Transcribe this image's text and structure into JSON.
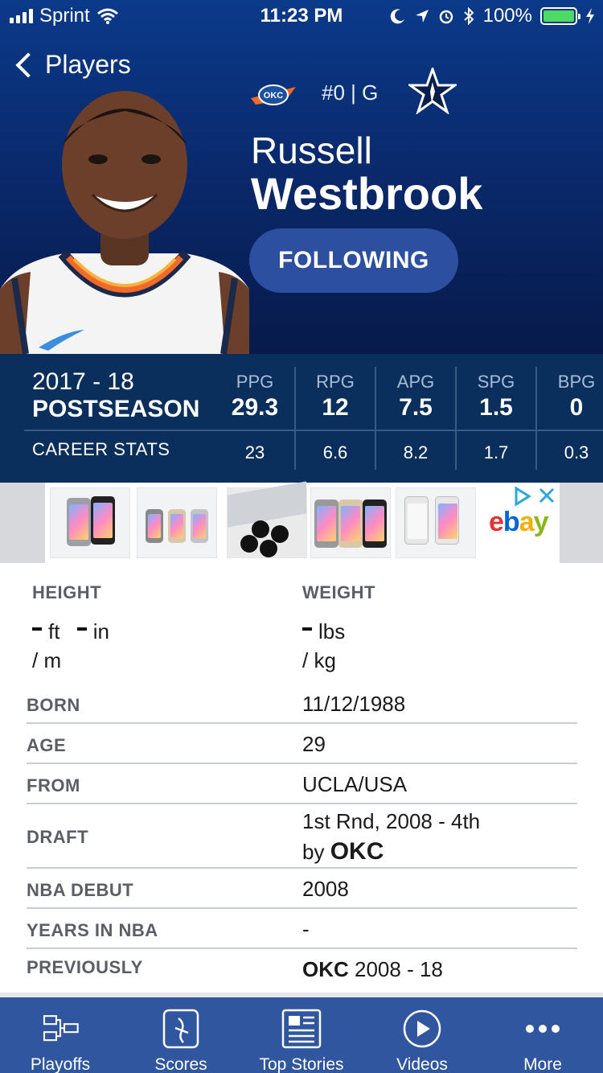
{
  "status_bar": {
    "carrier": "Sprint",
    "time": "11:23 PM",
    "battery": "100%"
  },
  "nav": {
    "back_label": "Players"
  },
  "player": {
    "number_position": "#0  |  G",
    "first_name": "Russell",
    "last_name": "Westbrook",
    "follow_label": "FOLLOWING",
    "team_abbr": "OKC"
  },
  "stats": {
    "season_year": "2017 - 18",
    "season_type": "POSTSEASON",
    "career_label": "CAREER STATS",
    "columns": [
      {
        "label": "PPG",
        "value": "29.3",
        "career": "23"
      },
      {
        "label": "RPG",
        "value": "12",
        "career": "6.6"
      },
      {
        "label": "APG",
        "value": "7.5",
        "career": "8.2"
      },
      {
        "label": "SPG",
        "value": "1.5",
        "career": "1.7"
      },
      {
        "label": "BPG",
        "value": "0",
        "career": "0.3"
      }
    ]
  },
  "ad": {
    "brand": "ebay",
    "brand_colors": [
      "#e53238",
      "#0064d2",
      "#f5af02",
      "#86b817"
    ]
  },
  "bio": {
    "height_label": "HEIGHT",
    "height_ft": "ft",
    "height_in": "in",
    "height_m": "/  m",
    "weight_label": "WEIGHT",
    "weight_lbs": "lbs",
    "weight_kg": "/  kg",
    "rows": [
      {
        "key": "BORN",
        "value": "11/12/1988"
      },
      {
        "key": "AGE",
        "value": "29"
      },
      {
        "key": "FROM",
        "value": "UCLA/USA"
      },
      {
        "key": "DRAFT",
        "value_line1": "1st Rnd, 2008 - 4th",
        "value_prefix": "by ",
        "value_bold": "OKC"
      },
      {
        "key": "NBA DEBUT",
        "value": "2008"
      },
      {
        "key": "YEARS IN NBA",
        "value": "-"
      },
      {
        "key": "PREVIOUSLY",
        "value_bold": "OKC",
        "value_rest": " 2008 - 18"
      }
    ]
  },
  "tabs": [
    {
      "label": "Playoffs",
      "icon": "bracket-icon"
    },
    {
      "label": "Scores",
      "icon": "scores-icon"
    },
    {
      "label": "Top Stories",
      "icon": "news-icon"
    },
    {
      "label": "Videos",
      "icon": "play-icon"
    },
    {
      "label": "More",
      "icon": "more-icon"
    }
  ]
}
